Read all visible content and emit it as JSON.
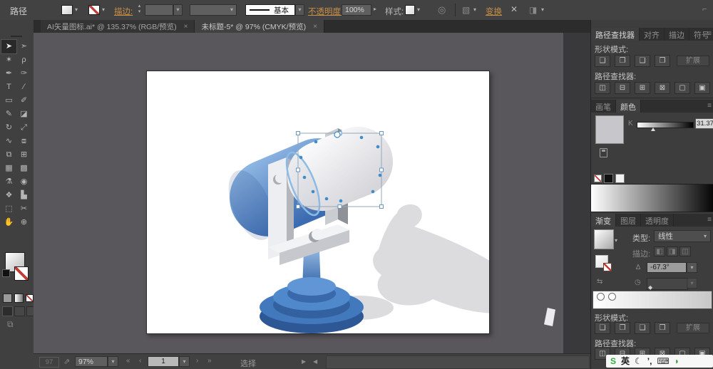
{
  "glyphs": {
    "caret": "▾",
    "caret_right": "▸",
    "step_up": "▴",
    "step_down": "▾",
    "menu": "≡",
    "recolor": "◎",
    "select_similar": "▧",
    "transform_x": "✕",
    "arrange": "◨",
    "collapse": "⌐",
    "export": "⇗",
    "nav_first": "«",
    "nav_prev": "‹",
    "nav_next": "›",
    "nav_last": "»",
    "scroll_left": "◀",
    "scroll_right": "▶",
    "reverse": "⇆",
    "angle": "∆",
    "aspect": "◷",
    "diamond": "◆"
  },
  "control_bar": {
    "context_label": "路径",
    "stroke_label": "描边:",
    "stroke_style_value": "基本",
    "opacity_label": "不透明度:",
    "opacity_value": "100%",
    "style_label": "样式:",
    "transform_label": "变换"
  },
  "document_tabs": [
    {
      "name": "document-tab-1",
      "title": "AI矢量图标.ai* @ 135.37% (RGB/预览)",
      "close": "×"
    },
    {
      "name": "document-tab-2",
      "title": "未标题-5* @ 97% (CMYK/预览)",
      "close": "×",
      "active": true
    }
  ],
  "toolbox": {
    "tools": [
      {
        "name": "selection-tool",
        "glyph": "➤",
        "active": true
      },
      {
        "name": "direct-selection-tool",
        "glyph": "➣"
      },
      {
        "name": "magic-wand-tool",
        "glyph": "✶"
      },
      {
        "name": "lasso-tool",
        "glyph": "ρ"
      },
      {
        "name": "pen-tool",
        "glyph": "✒"
      },
      {
        "name": "curvature-tool",
        "glyph": "✑"
      },
      {
        "name": "type-tool",
        "glyph": "T"
      },
      {
        "name": "line-segment-tool",
        "glyph": "∕"
      },
      {
        "name": "rectangle-tool",
        "glyph": "▭"
      },
      {
        "name": "paintbrush-tool",
        "glyph": "✐"
      },
      {
        "name": "pencil-tool",
        "glyph": "✎"
      },
      {
        "name": "eraser-tool",
        "glyph": "◪"
      },
      {
        "name": "rotate-tool",
        "glyph": "↻"
      },
      {
        "name": "scale-tool",
        "glyph": "⤢"
      },
      {
        "name": "width-tool",
        "glyph": "∿"
      },
      {
        "name": "free-transform-tool",
        "glyph": "⧈"
      },
      {
        "name": "shape-builder-tool",
        "glyph": "⧉"
      },
      {
        "name": "perspective-grid-tool",
        "glyph": "⊞"
      },
      {
        "name": "mesh-tool",
        "glyph": "▦"
      },
      {
        "name": "gradient-tool",
        "glyph": "▩"
      },
      {
        "name": "eyedropper-tool",
        "glyph": "⚗"
      },
      {
        "name": "symbol-sprayer-tool",
        "glyph": "◉"
      },
      {
        "name": "blend-tool",
        "glyph": "❖"
      },
      {
        "name": "graph-tool",
        "glyph": "▙"
      },
      {
        "name": "artboard-tool",
        "glyph": "⬚"
      },
      {
        "name": "slice-tool",
        "glyph": "✂"
      },
      {
        "name": "hand-tool",
        "glyph": "✋"
      },
      {
        "name": "zoom-tool",
        "glyph": "⊕"
      }
    ]
  },
  "panels": {
    "pathfinder": {
      "tabs": [
        {
          "name": "tab-pathfinder",
          "label": "路径查找器",
          "active": true
        },
        {
          "name": "tab-align",
          "label": "对齐"
        },
        {
          "name": "tab-stroke",
          "label": "描边"
        },
        {
          "name": "tab-symbols",
          "label": "符号"
        }
      ],
      "shape_modes_label": "形状模式:",
      "expand_label": "扩展",
      "pathfinder_label": "路径查找器:",
      "shape_mode_buttons": [
        {
          "name": "unite-icon",
          "glyph": "❏"
        },
        {
          "name": "minus-front-icon",
          "glyph": "❐"
        },
        {
          "name": "intersect-icon",
          "glyph": "❑"
        },
        {
          "name": "exclude-icon",
          "glyph": "❒"
        }
      ],
      "pathfinder_buttons": [
        {
          "name": "divide-icon",
          "glyph": "◫"
        },
        {
          "name": "trim-icon",
          "glyph": "⊟"
        },
        {
          "name": "merge-icon",
          "glyph": "⊞"
        },
        {
          "name": "crop-icon",
          "glyph": "⊠"
        },
        {
          "name": "outline-icon",
          "glyph": "▢"
        },
        {
          "name": "minus-back-icon",
          "glyph": "▣"
        }
      ]
    },
    "color": {
      "tabs": [
        {
          "name": "tab-brushes",
          "label": "画笔"
        },
        {
          "name": "tab-color",
          "label": "颜色",
          "active": true
        }
      ],
      "k_label": "K",
      "k_value": "31.37"
    },
    "gradient": {
      "tabs": [
        {
          "name": "tab-gradient",
          "label": "渐变",
          "active": true
        },
        {
          "name": "tab-layers",
          "label": "图层"
        },
        {
          "name": "tab-transparency",
          "label": "透明度"
        }
      ],
      "type_label": "类型:",
      "type_value": "线性",
      "stroke_label": "描边:",
      "stroke_buttons": [
        {
          "name": "stroke-within-icon",
          "glyph": "◧"
        },
        {
          "name": "stroke-along-icon",
          "glyph": "◨"
        },
        {
          "name": "stroke-across-icon",
          "glyph": "◫"
        }
      ],
      "angle_value": "-67.3°"
    },
    "pathfinder2": {
      "shape_modes_label": "形状模式:",
      "expand_label": "扩展",
      "pathfinder_label": "路径查找器:"
    }
  },
  "status_bar": {
    "zoom_ghost": "97",
    "zoom_value": "97%",
    "artboard_value": "1",
    "tool_status": "选择"
  },
  "ime_bar": {
    "items": [
      {
        "name": "sogou-logo-icon",
        "label": "S",
        "color": "#2fae3c"
      },
      {
        "name": "english-mode-icon",
        "label": "英",
        "color": "#1a1a1a"
      },
      {
        "name": "moon-icon",
        "label": "☾",
        "color": "#1a1a1a"
      },
      {
        "name": "punctuation-icon",
        "label": "’,",
        "color": "#1a1a1a"
      },
      {
        "name": "keyboard-icon",
        "label": "⌨",
        "color": "#333333"
      },
      {
        "name": "more-icon",
        "label": "◗",
        "color": "#3f9d44"
      }
    ]
  },
  "illustration": {
    "light_blue": "#96bde8",
    "body_blue": "#3b6bb1",
    "base_blue": "#4278bc",
    "lamp_white": "#f5f5f7",
    "stand_gray": "#eceef1",
    "shadow_gray": "#dcdcdf",
    "selection_blue": "#3f8ccb"
  }
}
